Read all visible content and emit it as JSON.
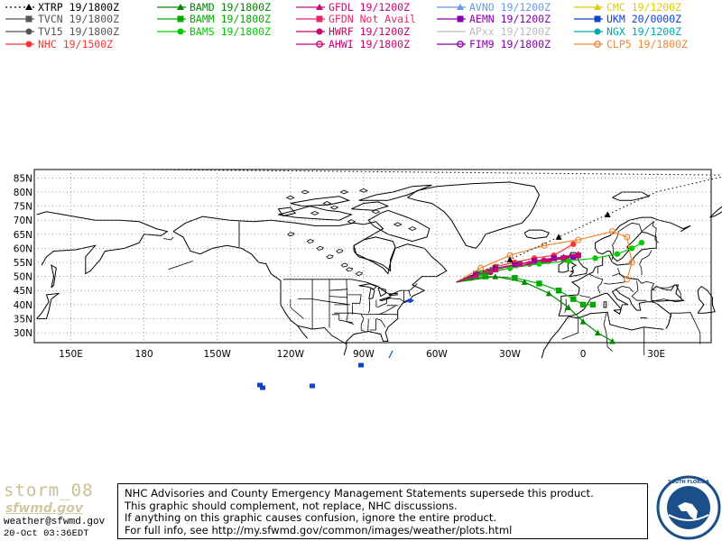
{
  "legend": [
    {
      "label": "XTRP 19/1800Z",
      "color": "#000000",
      "line": "dotted",
      "marker": "triangle",
      "col": 0,
      "row": 0
    },
    {
      "label": "TVCN 19/1800Z",
      "color": "#555555",
      "line": "solid",
      "marker": "square",
      "col": 0,
      "row": 1
    },
    {
      "label": "TV15 19/1800Z",
      "color": "#555555",
      "line": "solid",
      "marker": "circle",
      "col": 0,
      "row": 2
    },
    {
      "label": "NHC 19/1500Z",
      "color": "#ff3333",
      "line": "solid",
      "marker": "circle",
      "col": 0,
      "row": 3
    },
    {
      "label": "BAMD 19/1800Z",
      "color": "#008800",
      "line": "solid",
      "marker": "triangle",
      "col": 1,
      "row": 0
    },
    {
      "label": "BAMM 19/1800Z",
      "color": "#00aa00",
      "line": "solid",
      "marker": "square",
      "col": 1,
      "row": 1
    },
    {
      "label": "BAMS 19/1800Z",
      "color": "#00cc00",
      "line": "solid",
      "marker": "circle",
      "col": 1,
      "row": 2
    },
    {
      "label": "GFDL 19/1200Z",
      "color": "#cc0077",
      "line": "solid",
      "marker": "triangle",
      "col": 2,
      "row": 0
    },
    {
      "label": "GFDN Not Avail",
      "color": "#ee2266",
      "line": "solid",
      "marker": "square",
      "col": 2,
      "row": 1
    },
    {
      "label": "HWRF 19/1200Z",
      "color": "#cc0066",
      "line": "solid",
      "marker": "circle",
      "col": 2,
      "row": 2
    },
    {
      "label": "AHWI 19/1800Z",
      "color": "#cc0077",
      "line": "solid",
      "marker": "open-circle",
      "col": 2,
      "row": 3
    },
    {
      "label": "AVNO 19/1200Z",
      "color": "#6699ee",
      "line": "solid",
      "marker": "triangle",
      "col": 3,
      "row": 0
    },
    {
      "label": "AEMN 19/1200Z",
      "color": "#8800aa",
      "line": "solid",
      "marker": "square",
      "col": 3,
      "row": 1
    },
    {
      "label": "APxx 19/1200Z",
      "color": "#bbbbbb",
      "line": "solid",
      "marker": "none",
      "col": 3,
      "row": 2
    },
    {
      "label": "FIM9 19/1800Z",
      "color": "#8800aa",
      "line": "solid",
      "marker": "open-circle",
      "col": 3,
      "row": 3
    },
    {
      "label": "CMC 19/1200Z",
      "color": "#ddcc00",
      "line": "solid",
      "marker": "triangle",
      "col": 4,
      "row": 0
    },
    {
      "label": "UKM 20/0000Z",
      "color": "#1144cc",
      "line": "solid",
      "marker": "square",
      "col": 4,
      "row": 1
    },
    {
      "label": "NGX 19/1200Z",
      "color": "#00aaaa",
      "line": "solid",
      "marker": "circle",
      "col": 4,
      "row": 2
    },
    {
      "label": "CLP5 19/1800Z",
      "color": "#ee8833",
      "line": "solid",
      "marker": "open-circle",
      "col": 4,
      "row": 3
    }
  ],
  "map": {
    "lat_labels": [
      "85N",
      "80N",
      "75N",
      "70N",
      "65N",
      "60N",
      "55N",
      "50N",
      "45N",
      "40N",
      "35N",
      "30N"
    ],
    "lon_labels": [
      "150E",
      "180",
      "150W",
      "120W",
      "90W",
      "60W",
      "30W",
      "0",
      "30E"
    ],
    "lon_ticks": [
      150,
      180,
      210,
      240,
      270,
      300,
      330,
      360,
      390
    ]
  },
  "tracks": {
    "NHC": {
      "color": "#ff3333",
      "points": [
        [
          -52,
          48
        ],
        [
          -44,
          51
        ],
        [
          -36,
          53.5
        ],
        [
          -28,
          55
        ],
        [
          -20,
          56.5
        ],
        [
          -12,
          57.5
        ],
        [
          -4,
          61.5
        ]
      ]
    },
    "TVCN": {
      "color": "#555555",
      "points": [
        [
          -52,
          48
        ],
        [
          -44,
          51
        ],
        [
          -36,
          53
        ],
        [
          -26,
          54.5
        ],
        [
          -16,
          55.5
        ],
        [
          -8,
          56.5
        ],
        [
          -2,
          57.5
        ]
      ]
    },
    "HWRF": {
      "color": "#cc0066",
      "points": [
        [
          -52,
          48
        ],
        [
          -46,
          49.5
        ],
        [
          -38,
          51.5
        ],
        [
          -30,
          53
        ],
        [
          -22,
          54.5
        ],
        [
          -14,
          55.5
        ],
        [
          -7,
          56.5
        ],
        [
          -2,
          57.5
        ]
      ]
    },
    "AEMN": {
      "color": "#8800aa",
      "points": [
        [
          -52,
          48
        ],
        [
          -44,
          50.5
        ],
        [
          -36,
          52.5
        ],
        [
          -28,
          54
        ],
        [
          -20,
          55.5
        ],
        [
          -12,
          56.5
        ],
        [
          -4,
          57
        ]
      ]
    },
    "CLP5": {
      "color": "#ee8833",
      "points": [
        [
          -52,
          48
        ],
        [
          -42,
          53
        ],
        [
          -30,
          57.5
        ],
        [
          -16,
          61
        ],
        [
          -2,
          63
        ],
        [
          12,
          66
        ],
        [
          18,
          64
        ],
        [
          20,
          55
        ],
        [
          18,
          49
        ]
      ]
    },
    "BAMS": {
      "color": "#00cc00",
      "points": [
        [
          -52,
          48
        ],
        [
          -42,
          51
        ],
        [
          -30,
          53
        ],
        [
          -18,
          54.5
        ],
        [
          -6,
          55.5
        ],
        [
          5,
          56.5
        ],
        [
          14,
          58
        ],
        [
          20,
          60
        ],
        [
          24,
          62
        ]
      ]
    },
    "BAMM": {
      "color": "#00aa00",
      "points": [
        [
          -52,
          48
        ],
        [
          -40,
          50
        ],
        [
          -28,
          49.5
        ],
        [
          -18,
          47.5
        ],
        [
          -10,
          45
        ],
        [
          -4,
          42
        ],
        [
          0,
          40
        ],
        [
          4,
          40
        ]
      ]
    },
    "BAMD": {
      "color": "#008800",
      "points": [
        [
          -52,
          48
        ],
        [
          -36,
          50
        ],
        [
          -24,
          48
        ],
        [
          -14,
          44
        ],
        [
          -6,
          39
        ],
        [
          0,
          34
        ],
        [
          6,
          30
        ],
        [
          12,
          27
        ]
      ]
    },
    "XTRP": {
      "color": "#000000",
      "points": [
        [
          -52,
          48
        ],
        [
          -30,
          56
        ],
        [
          -10,
          64
        ],
        [
          10,
          72
        ],
        [
          30,
          80
        ],
        [
          60,
          86
        ],
        [
          180,
          88
        ]
      ]
    },
    "GFDL": {
      "color": "#cc0077",
      "points": [
        [
          -52,
          48
        ],
        [
          -44,
          50.5
        ],
        [
          -36,
          52.5
        ],
        [
          -26,
          54.5
        ],
        [
          -16,
          56
        ],
        [
          -8,
          57
        ],
        [
          -2,
          58
        ]
      ]
    }
  },
  "footer": {
    "storm": "storm_08",
    "site": "sfwmd.gov",
    "email": "weather@sfwmd.gov",
    "date": "20-Oct 03:36EDT"
  },
  "disclaimer": [
    "NHC Advisories and County Emergency Management Statements supersede this product.",
    "This graphic should complement, not replace, NHC discussions.",
    "If anything on this graphic causes confusion, ignore the entire product.",
    "For full info, see   http://my.sfwmd.gov/common/images/weather/plots.html"
  ],
  "logo_text": "SOUTH FLORIDA WATER MANAGEMENT DISTRICT"
}
